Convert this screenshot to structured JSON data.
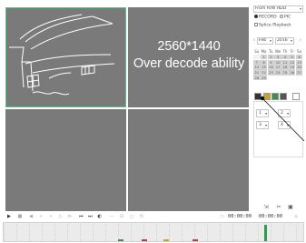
{
  "overlay": {
    "resolution": "2560*1440",
    "message": "Over decode ability"
  },
  "panel": {
    "source": "From R/W HDD",
    "record_label": "RECORD",
    "pic_label": "PIC",
    "splice_label": "Splice Playback",
    "month": "Feb",
    "year": "2016",
    "weekdays": [
      "Su",
      "Mo",
      "Tu",
      "We",
      "Th",
      "Fr",
      "Sa"
    ],
    "days": [
      "",
      "1",
      "2",
      "3",
      "4",
      "5",
      "6",
      "7",
      "8",
      "9",
      "10",
      "11",
      "12",
      "13",
      "14",
      "15",
      "16",
      "17",
      "18",
      "19",
      "20",
      "21",
      "22",
      "23",
      "24",
      "25",
      "26",
      "27",
      "28",
      "29"
    ],
    "channel_a": "1",
    "channel_b": "2",
    "channel_c": "3",
    "channel_d": "4"
  },
  "playback": {
    "start_time": "00:00:00",
    "end_time": "00:00:00"
  },
  "colors": {
    "accent": "#5ec28c",
    "video_bg": "#7a7a7a",
    "swatch_1": "#333333",
    "swatch_2": "#c9a227",
    "swatch_3": "#3d8f4c",
    "swatch_4": "#555555"
  }
}
